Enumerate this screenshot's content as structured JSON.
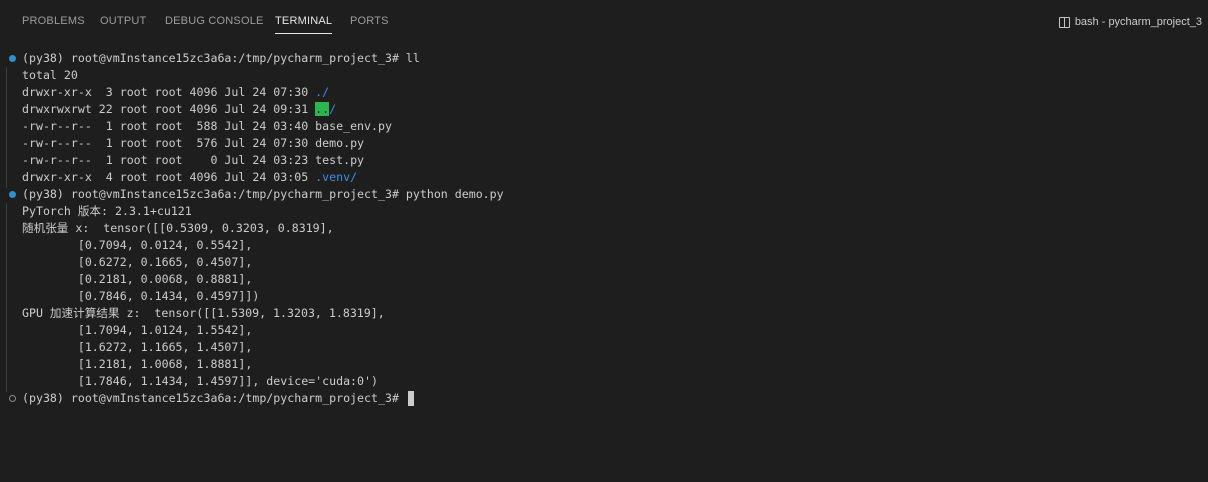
{
  "panel_tabs": [
    {
      "label": "PROBLEMS",
      "active": false
    },
    {
      "label": "OUTPUT",
      "active": false
    },
    {
      "label": "DEBUG CONSOLE",
      "active": false
    },
    {
      "label": "TERMINAL",
      "active": true
    },
    {
      "label": "PORTS",
      "active": false
    }
  ],
  "terminal_title": "bash - pycharm_project_3",
  "colors": {
    "background": "#1e1e1e",
    "text": "#cccccc",
    "directory": "#3b8eea",
    "highlight": "#2db64f",
    "decoration_success": "#2f8fd1"
  },
  "terminal": {
    "prompt": "(py38) root@vmInstance15zc3a6a:/tmp/pycharm_project_3#",
    "cmd1": "ll",
    "total": "total 20",
    "ls_entries": [
      {
        "meta": "drwxr-xr-x  3 root root 4096 Jul 24 07:30 ",
        "name": ".",
        "suffix": "/"
      },
      {
        "meta": "drwxrwxrwt 22 root root 4096 Jul 24 09:31 ",
        "name": "..",
        "suffix": "/"
      },
      {
        "meta": "-rw-r--r--  1 root root  588 Jul 24 03:40 ",
        "name": "base_env.py",
        "suffix": ""
      },
      {
        "meta": "-rw-r--r--  1 root root  576 Jul 24 07:30 ",
        "name": "demo.py",
        "suffix": ""
      },
      {
        "meta": "-rw-r--r--  1 root root    0 Jul 24 03:23 ",
        "name": "test.py",
        "suffix": ""
      },
      {
        "meta": "drwxr-xr-x  4 root root 4096 Jul 24 03:05 ",
        "name": ".venv",
        "suffix": "/"
      }
    ],
    "cmd2": "python demo.py",
    "output": [
      "PyTorch 版本: 2.3.1+cu121",
      "随机张量 x:  tensor([[0.5309, 0.3203, 0.8319],",
      "        [0.7094, 0.0124, 0.5542],",
      "        [0.6272, 0.1665, 0.4507],",
      "        [0.2181, 0.0068, 0.8881],",
      "        [0.7846, 0.1434, 0.4597]])",
      "GPU 加速计算结果 z:  tensor([[1.5309, 1.3203, 1.8319],",
      "        [1.7094, 1.0124, 1.5542],",
      "        [1.6272, 1.1665, 1.4507],",
      "        [1.2181, 1.0068, 1.8881],",
      "        [1.7846, 1.1434, 1.4597]], device='cuda:0')"
    ]
  }
}
